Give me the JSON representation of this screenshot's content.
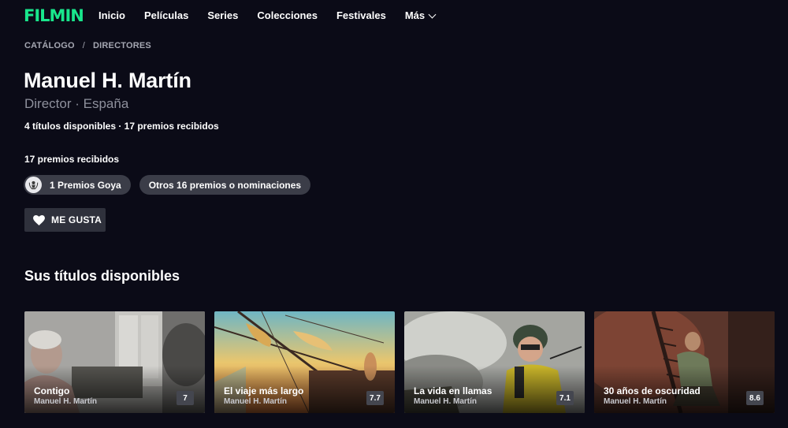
{
  "app": {
    "logo": "FILMIN",
    "brand_color": "#19e68c"
  },
  "nav": {
    "items": [
      {
        "label": "Inicio"
      },
      {
        "label": "Películas"
      },
      {
        "label": "Series"
      },
      {
        "label": "Colecciones"
      },
      {
        "label": "Festivales"
      },
      {
        "label": "Más",
        "icon": "chevron-down-icon"
      }
    ]
  },
  "breadcrumb": {
    "items": [
      {
        "label": "CATÁLOGO"
      },
      {
        "label": "DIRECTORES"
      }
    ],
    "separator": "/"
  },
  "person": {
    "name": "Manuel H. Martín",
    "subtitle": "Director · España",
    "stats": "4 títulos disponibles · 17 premios recibidos"
  },
  "awards": {
    "heading": "17 premios recibidos",
    "chips": [
      {
        "label": "1 Premios Goya",
        "icon": "goya-award-icon"
      },
      {
        "label": "Otros 16 premios o nominaciones"
      }
    ]
  },
  "actions": {
    "like_label": "ME GUSTA",
    "like_icon": "heart-icon"
  },
  "titles_section": {
    "heading": "Sus títulos disponibles",
    "cards": [
      {
        "title": "Contigo",
        "director": "Manuel H. Martín",
        "rating": "7"
      },
      {
        "title": "El viaje más largo",
        "director": "Manuel H. Martín",
        "rating": "7.7"
      },
      {
        "title": "La vida en llamas",
        "director": "Manuel H. Martín",
        "rating": "7.1"
      },
      {
        "title": "30 años de oscuridad",
        "director": "Manuel H. Martín",
        "rating": "8.6"
      }
    ]
  }
}
